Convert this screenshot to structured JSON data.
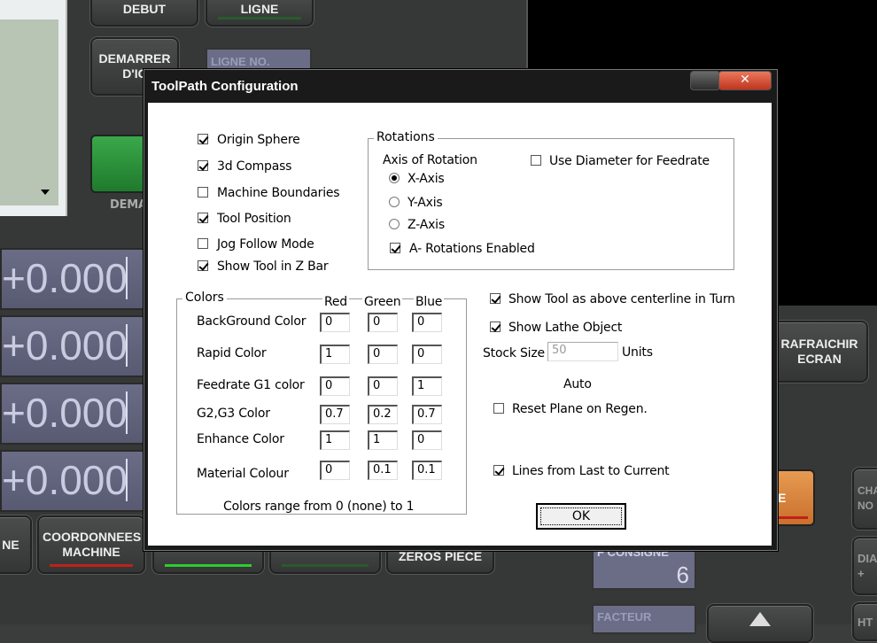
{
  "background": {
    "buttons": {
      "debut": "DEBUT",
      "ligne": "LIGNE",
      "demarrer": "DEMARRER D'IC",
      "dem_partial": "DEMA",
      "ligne_no": "LIGNE NO.",
      "rafraichir": "RAFRAICHIR ECRAN",
      "coordonnees": "COORDONNEES MACHINE",
      "partial_ne": "NE",
      "zeros_piece": "ZEROS PIECE",
      "consigne": "F CONSIGNE",
      "consigne_val": "6",
      "facteur": "FACTEUR",
      "cha": "CHA",
      "no": "NO",
      "dia": "DIA",
      "ht": "HT",
      "plus": "+",
      "e_partial": "E"
    },
    "dro_values": [
      "+0.000",
      "+0.000",
      "+0.000",
      "+0.000"
    ]
  },
  "dialog": {
    "title": "ToolPath Configuration",
    "close_glyph": "✕",
    "options": [
      {
        "label": "Origin Sphere",
        "checked": true
      },
      {
        "label": "3d Compass",
        "checked": true
      },
      {
        "label": "Machine Boundaries",
        "checked": false
      },
      {
        "label": "Tool Position",
        "checked": true
      },
      {
        "label": "Jog Follow Mode",
        "checked": false
      },
      {
        "label": "Show Tool in Z Bar",
        "checked": true
      }
    ],
    "rotations": {
      "caption": "Rotations",
      "axis_label": "Axis of Rotation",
      "use_diameter": "Use Diameter for Feedrate",
      "x_axis": "X-Axis",
      "y_axis": "Y-Axis",
      "z_axis": "Z-Axis",
      "selected": "X-Axis",
      "a_rotations": "A- Rotations Enabled"
    },
    "colors": {
      "caption": "Colors",
      "headers": [
        "Red",
        "Green",
        "Blue"
      ],
      "rows": [
        {
          "label": "BackGround Color",
          "values": [
            "0",
            "0",
            "0"
          ]
        },
        {
          "label": "Rapid Color",
          "values": [
            "1",
            "0",
            "0"
          ]
        },
        {
          "label": "Feedrate G1 color",
          "values": [
            "0",
            "0",
            "1"
          ]
        },
        {
          "label": "G2,G3 Color",
          "values": [
            "0.7",
            "0.2",
            "0.7"
          ]
        },
        {
          "label": "Enhance Color",
          "values": [
            "1",
            "1",
            "0"
          ]
        },
        {
          "label": "Material Colour",
          "values": [
            "0",
            "0.1",
            "0.1"
          ]
        }
      ],
      "range_note": "Colors range from 0 (none) to 1"
    },
    "lathe": {
      "show_tool_above": "Show Tool as above centerline in Turn",
      "show_lathe_object": "Show Lathe Object",
      "stock_size_label": "Stock Size",
      "stock_size_value": "50",
      "units": "Units",
      "auto": "Auto",
      "reset_plane": "Reset Plane on Regen.",
      "lines_from_last": "Lines from Last to Current"
    },
    "ok_label": "OK"
  },
  "colors": {
    "dialog_frame": "#1a1a1a",
    "close_red": "#c2341c",
    "dro_bg": "#6b6c86",
    "bar_green": "#2ecc2e",
    "bar_red": "#c0201b",
    "orange": "#d9813a"
  }
}
